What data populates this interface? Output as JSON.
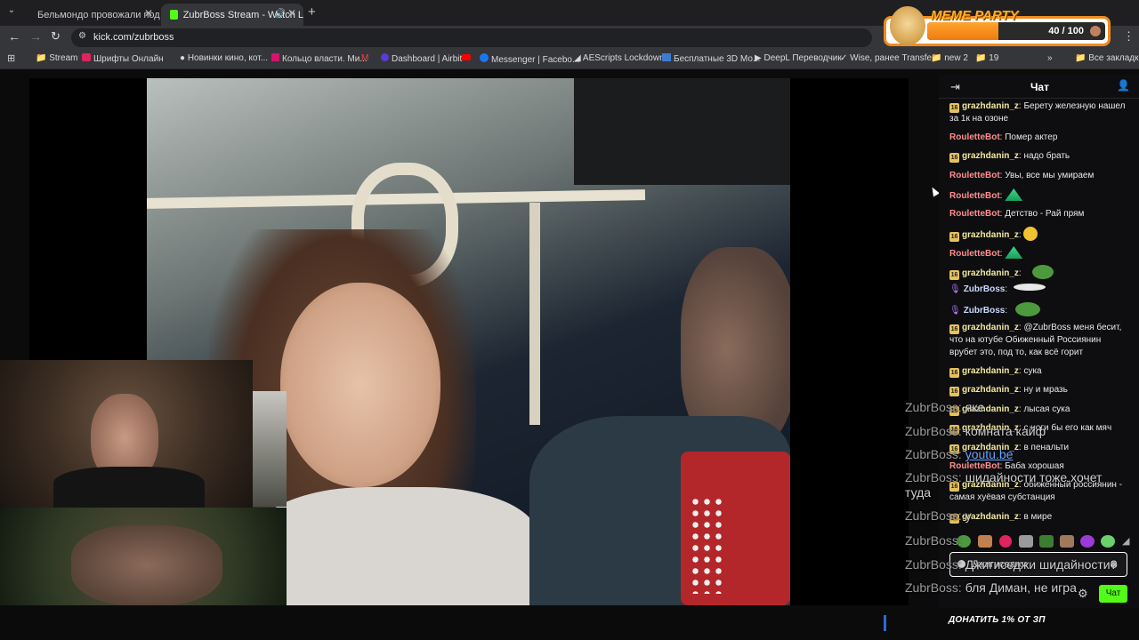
{
  "browser": {
    "tabs": [
      {
        "title": "Бельмондо провожали под м"
      },
      {
        "title": "ZubrBoss Stream - Watch L"
      }
    ],
    "new_tab": "+",
    "url": "kick.com/zubrboss",
    "bookmarks": [
      "Stream",
      "Шрифты Онлайн",
      "Новинки кино, кот...",
      "Кольцо власти. Ми...",
      "Dashboard | Airbit",
      "Messenger | Facebo...",
      "AEScripts Lockdown...",
      "Бесплатные 3D Мо...",
      "DeepL Переводчик",
      "Wise, ранее Transfe...",
      "new 2",
      "19",
      "Все закладки"
    ]
  },
  "meme_party": {
    "title": "MEME PARTY",
    "progress": "40 / 100"
  },
  "chat": {
    "header": "Чат",
    "messages": [
      {
        "user": "grazhdanin_z",
        "text": ": Берету железную нашел за 1к на озоне"
      },
      {
        "user": "RouletteBot",
        "text": ": Помер актер"
      },
      {
        "user": "grazhdanin_z",
        "text": ": надо брать"
      },
      {
        "user": "RouletteBot",
        "text": ": Увы, все мы умираем"
      },
      {
        "user": "RouletteBot",
        "text": ":"
      },
      {
        "user": "RouletteBot",
        "text": ": Детство - Рай прям"
      },
      {
        "user": "grazhdanin_z",
        "text": ":"
      },
      {
        "user": "RouletteBot",
        "text": ":"
      },
      {
        "user": "grazhdanin_z",
        "text": ":"
      },
      {
        "user": "ZubrBoss",
        "text": ":"
      },
      {
        "user": "ZubrBoss",
        "text": ":"
      },
      {
        "user": "grazhdanin_z",
        "text": ": @ZubrBoss меня бесит, что на ютубе Обиженный Россиянин врубет это, под то, как всё горит"
      },
      {
        "user": "grazhdanin_z",
        "text": ": сука"
      },
      {
        "user": "grazhdanin_z",
        "text": ": ну и мразь"
      },
      {
        "user": "grazhdanin_z",
        "text": ": лысая сука"
      },
      {
        "user": "grazhdanin_z",
        "text": ": с ноги бы его как мяч"
      },
      {
        "user": "grazhdanin_z",
        "text": ": в пенальти"
      },
      {
        "user": "RouletteBot",
        "text": ": Баба хорошая"
      },
      {
        "user": "grazhdanin_z",
        "text": ": обиженный россиянин - самая хуёвая субстанция"
      },
      {
        "user": "grazhdanin_z",
        "text": ": в мире"
      }
    ],
    "badge_label": "16",
    "input_placeholder": "Джигиседжи",
    "send_button": "Чат",
    "donate_banner": "ДОНАТИТЬ 1% ОТ ЗП"
  },
  "overlay_chat": [
    {
      "name": "ZubrBoss:",
      "text": "яке"
    },
    {
      "name": "ZubrBoss:",
      "text": "комната кайф"
    },
    {
      "name": "ZubrBoss:",
      "text": "youtu.be"
    },
    {
      "name": "ZubrBoss:",
      "text": "шидайности тоже хочет"
    },
    {
      "name": "",
      "text": "туда"
    },
    {
      "name": "ZubrBoss:",
      "text": "у"
    },
    {
      "name": "ZubrBoss:",
      "text": ""
    },
    {
      "name": "ZubrBoss:",
      "text": "Джигиседжи шидайности?"
    },
    {
      "name": "ZubrBoss:",
      "text": "бля Диман, не игра"
    }
  ]
}
